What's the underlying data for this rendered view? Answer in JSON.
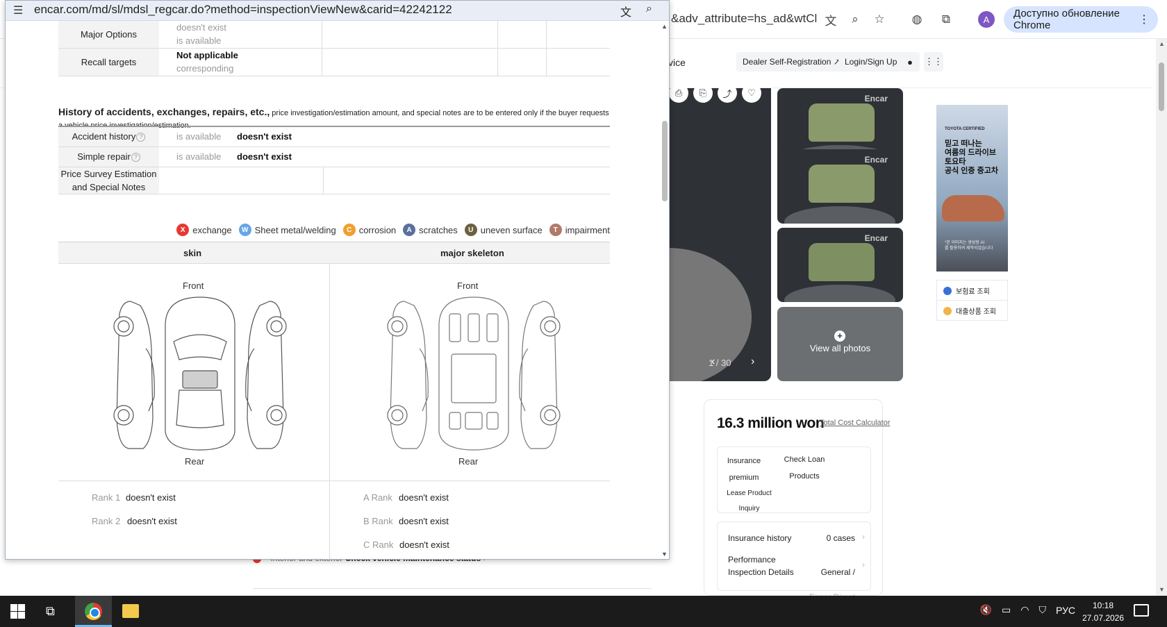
{
  "background_browser": {
    "url_visible": "&adv_attribute=hs_ad&wtCli...",
    "update_button": "Доступно обновление Chrome",
    "avatar_letter": "A",
    "subnav_partial": "vice",
    "dealer_registration": "Dealer Self-Registration ↗",
    "login": "Login/Sign Up",
    "photo_counter": "1 / 30",
    "watermark": "Encar",
    "view_all_photos": "View all photos",
    "ad": {
      "brand": "TOYOTA CERTIFIED",
      "copy": "믿고 떠나는\n여름의 드라이브\n토요타\n공식 인증 중고차",
      "fine": "*본 이미지는 생성형 AI\n를 활용하여 제작되었습니다",
      "link1": "보험료 조회",
      "link2": "대출상품 조회"
    },
    "price_card": {
      "price": "16.3 million won",
      "calculator": "Total Cost Calculator",
      "insurance": "Insurance\npremium",
      "check_loan": "Check Loan\nProducts",
      "lease": "Lease Product\nInquiry",
      "history_label": "Insurance history",
      "history_value": "0 cases",
      "perf_label": "Performance\nInspection Details",
      "perf_value": "General /",
      "perf_value2": "Encar Direct"
    },
    "partial_row_text": "Interior and exterior",
    "partial_row_link": "Check vehicle maintenance status",
    "partial_row_arrow": "›"
  },
  "popup": {
    "url": "encar.com/md/sl/mdsl_regcar.do?method=inspectionViewNew&carid=42242122",
    "options_rows": [
      {
        "label": "Major Options",
        "line1": "doesn't exist",
        "line2": "is available"
      },
      {
        "label": "Recall targets",
        "line1": "Not applicable",
        "line2": "corresponding"
      }
    ],
    "history_heading": "History of accidents, exchanges, repairs, etc.,",
    "history_note": "price investigation/estimation amount, and special notes are to be entered only if the buyer requests a vehicle price investigation/estimation.",
    "history_rows": [
      {
        "label": "Accident history",
        "option": "is available",
        "value": "doesn't exist"
      },
      {
        "label": "Simple repair",
        "option": "is available",
        "value": "doesn't exist"
      }
    ],
    "price_survey_label": "Price Survey Estimation and Special Notes",
    "legend": [
      {
        "code": "X",
        "label": "exchange",
        "color": "#e53935"
      },
      {
        "code": "W",
        "label": "Sheet metal/welding",
        "color": "#64a6e8"
      },
      {
        "code": "C",
        "label": "corrosion",
        "color": "#f0a030"
      },
      {
        "code": "A",
        "label": "scratches",
        "color": "#5c6f9c"
      },
      {
        "code": "U",
        "label": "uneven surface",
        "color": "#6d6042"
      },
      {
        "code": "T",
        "label": "impairment",
        "color": "#b07a6a"
      }
    ],
    "skin_header": "skin",
    "skeleton_header": "major skeleton",
    "front": "Front",
    "rear": "Rear",
    "skin_ranks": [
      {
        "label": "Rank 1",
        "value": "doesn't exist"
      },
      {
        "label": "Rank 2",
        "value": "doesn't exist"
      }
    ],
    "skeleton_ranks": [
      {
        "label": "A Rank",
        "value": "doesn't exist"
      },
      {
        "label": "B Rank",
        "value": "doesn't exist"
      },
      {
        "label": "C Rank",
        "value": "doesn't exist"
      }
    ]
  },
  "taskbar": {
    "language": "РУС",
    "time": "10:18",
    "date": "27.07.2026"
  }
}
